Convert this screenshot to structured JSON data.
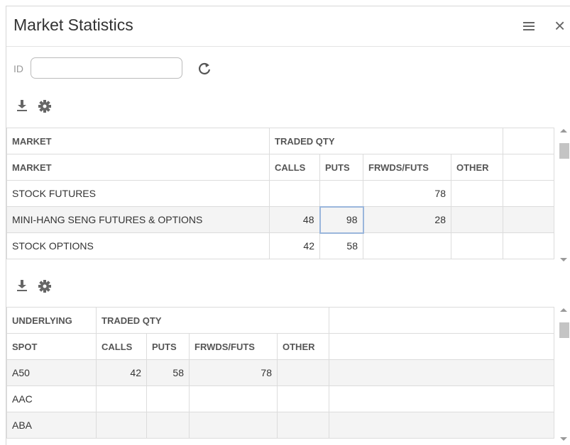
{
  "window": {
    "title": "Market Statistics"
  },
  "filter": {
    "id_label": "ID",
    "id_value": ""
  },
  "market_table": {
    "group_headers": [
      "MARKET",
      "TRADED QTY"
    ],
    "columns": [
      "MARKET",
      "CALLS",
      "PUTS",
      "FRWDS/FUTS",
      "OTHER"
    ],
    "rows": [
      {
        "market": "STOCK FUTURES",
        "calls": "",
        "puts": "",
        "frwds": "78",
        "other": ""
      },
      {
        "market": "MINI-HANG SENG FUTURES & OPTIONS",
        "calls": "48",
        "puts": "98",
        "frwds": "28",
        "other": ""
      },
      {
        "market": "STOCK OPTIONS",
        "calls": "42",
        "puts": "58",
        "frwds": "",
        "other": ""
      }
    ]
  },
  "underlying_table": {
    "group_headers": [
      "UNDERLYING",
      "TRADED QTY"
    ],
    "columns": [
      "SPOT",
      "CALLS",
      "PUTS",
      "FRWDS/FUTS",
      "OTHER"
    ],
    "rows": [
      {
        "spot": "A50",
        "calls": "42",
        "puts": "58",
        "frwds": "78",
        "other": ""
      },
      {
        "spot": "AAC",
        "calls": "",
        "puts": "",
        "frwds": "",
        "other": ""
      },
      {
        "spot": "ABA",
        "calls": "",
        "puts": "",
        "frwds": "",
        "other": ""
      }
    ]
  },
  "icons": {
    "menu": "hamburger-menu-icon",
    "close": "close-icon",
    "refresh": "refresh-icon",
    "download": "download-icon",
    "settings": "gear-icon"
  },
  "colors": {
    "selected_cell_border": "#9ab6dc",
    "alt_row_bg": "#f4f4f4",
    "grid_line": "#dcdcdc"
  }
}
